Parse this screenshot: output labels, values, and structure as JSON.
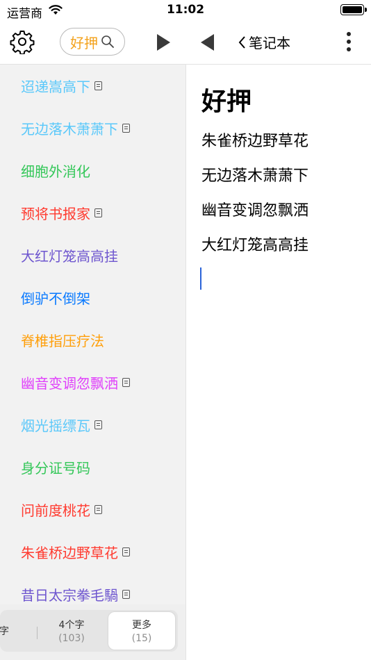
{
  "status_bar": {
    "carrier": "运营商",
    "time": "11:02"
  },
  "toolbar": {
    "search_label": "好押",
    "back_label": "笔记本"
  },
  "sidebar": {
    "items": [
      {
        "label": "迢递嵩高下",
        "color": "#5ac8fa",
        "doc": true
      },
      {
        "label": "无边落木萧萧下",
        "color": "#5ac8fa",
        "doc": true
      },
      {
        "label": "细胞外消化",
        "color": "#34c759",
        "doc": false
      },
      {
        "label": "预将书报家",
        "color": "#ff3b30",
        "doc": true
      },
      {
        "label": "大红灯笼高高挂",
        "color": "#6e56cf",
        "doc": false
      },
      {
        "label": "倒驴不倒架",
        "color": "#0a7aff",
        "doc": false
      },
      {
        "label": "脊椎指压疗法",
        "color": "#ff9f0a",
        "doc": false
      },
      {
        "label": "幽音变调忽飘洒",
        "color": "#e040fb",
        "doc": true
      },
      {
        "label": "烟光摇缥瓦",
        "color": "#5ac8fa",
        "doc": true
      },
      {
        "label": "身分证号码",
        "color": "#34c759",
        "doc": false
      },
      {
        "label": "问前度桃花",
        "color": "#ff3b30",
        "doc": true
      },
      {
        "label": "朱雀桥边野草花",
        "color": "#ff3b30",
        "doc": true
      },
      {
        "label": "昔日太宗拳毛騧",
        "color": "#6e56cf",
        "doc": true
      }
    ]
  },
  "segment": {
    "items": [
      {
        "label": "字",
        "count": ""
      },
      {
        "label": "4个字",
        "count": "(103)"
      },
      {
        "label": "更多",
        "count": "(15)"
      }
    ]
  },
  "note": {
    "title": "好押",
    "lines": [
      "朱雀桥边野草花",
      "无边落木萧萧下",
      "幽音变调忽飘洒",
      "大红灯笼高高挂"
    ]
  }
}
